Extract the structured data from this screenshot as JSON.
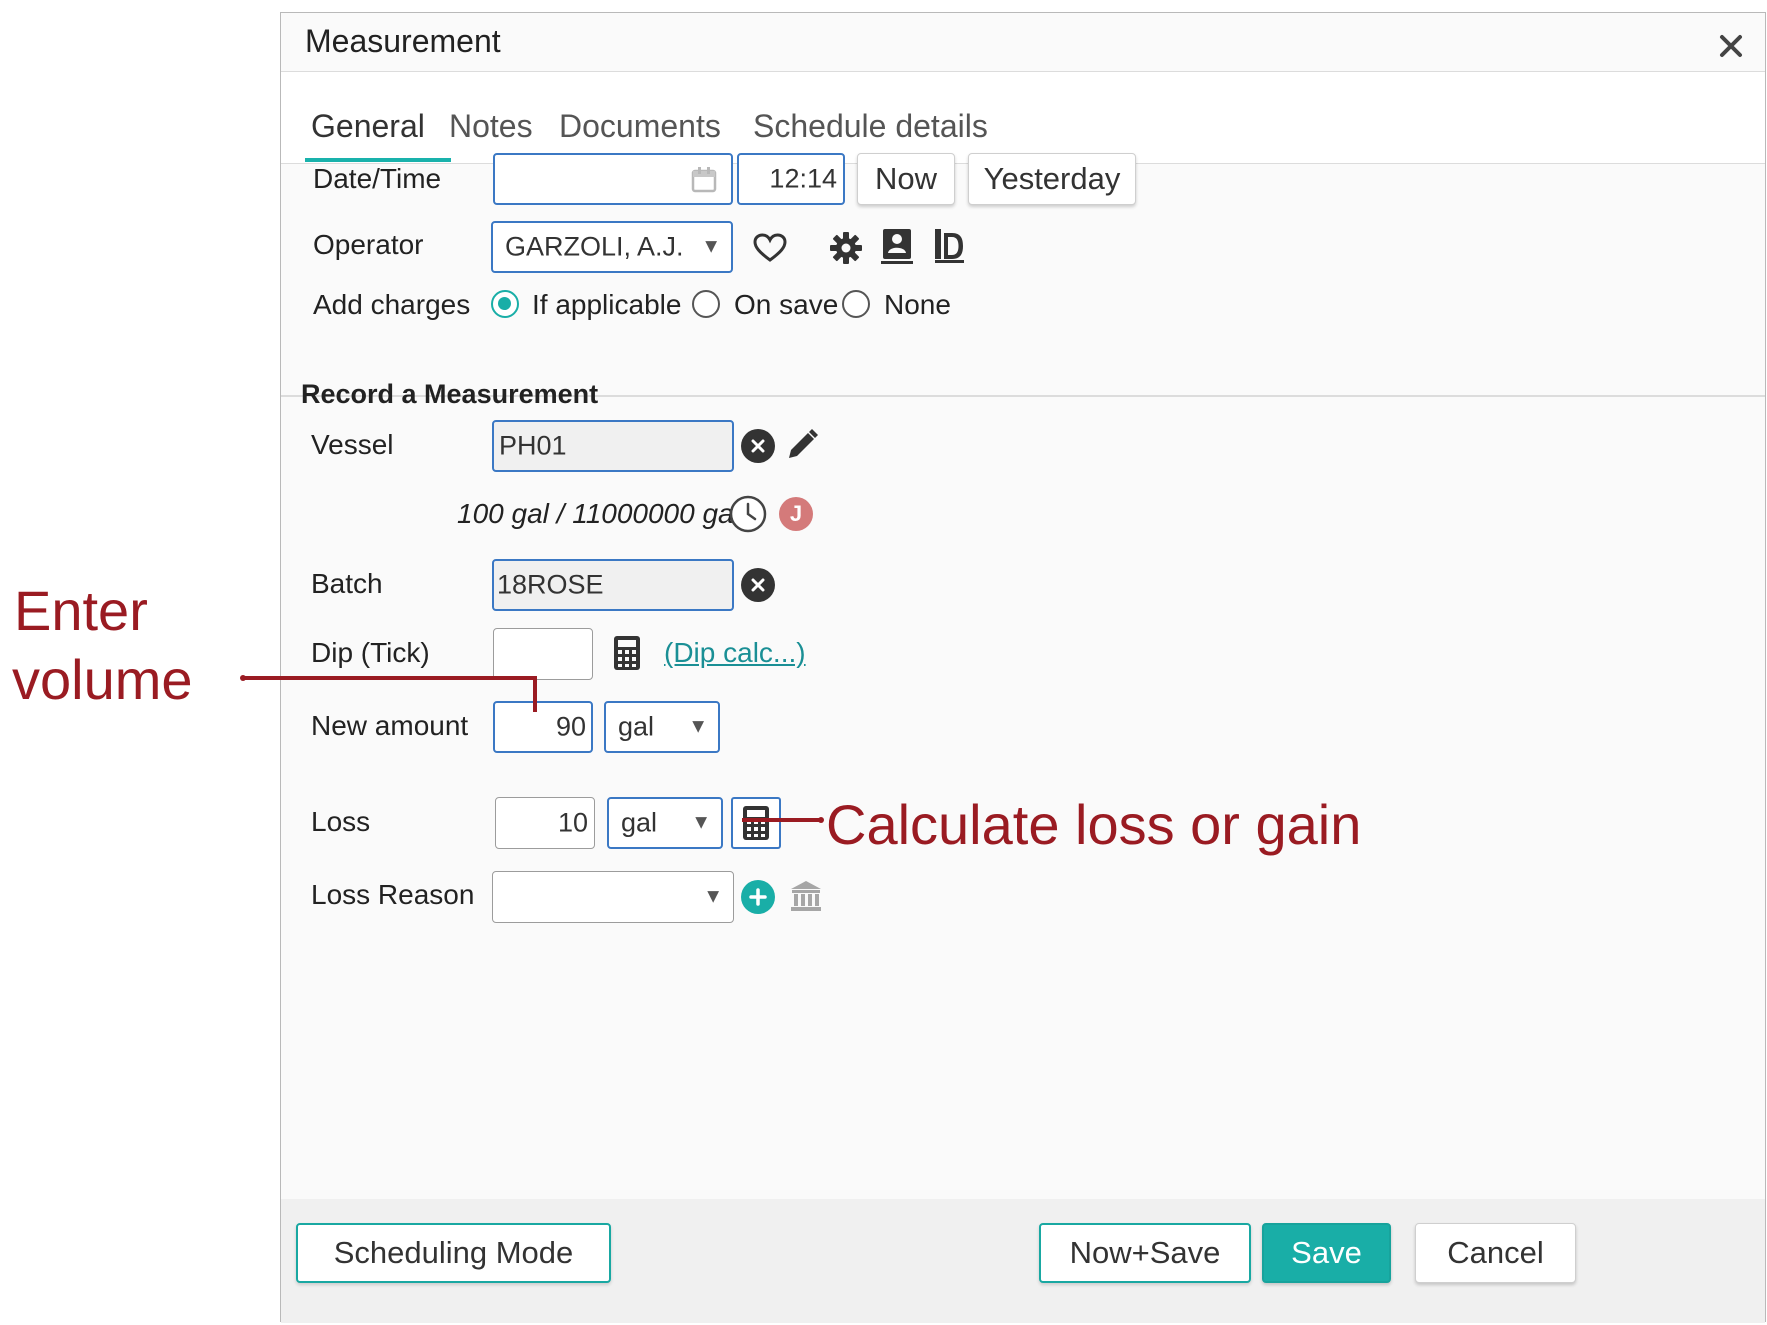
{
  "dialog": {
    "title": "Measurement",
    "close_icon": "close-icon"
  },
  "tabs": [
    {
      "label": "General",
      "active": true
    },
    {
      "label": "Notes",
      "active": false
    },
    {
      "label": "Documents",
      "active": false
    },
    {
      "label": "Schedule details",
      "active": false
    }
  ],
  "general": {
    "datetime_label": "Date/Time",
    "date_value": "",
    "time_value": "12:14",
    "now_label": "Now",
    "yesterday_label": "Yesterday",
    "operator_label": "Operator",
    "operator_value": "GARZOLI, A.J.",
    "add_charges_label": "Add charges",
    "charges_options": [
      {
        "label": "If applicable",
        "selected": true
      },
      {
        "label": "On save",
        "selected": false
      },
      {
        "label": "None",
        "selected": false
      }
    ]
  },
  "record": {
    "heading": "Record a Measurement",
    "vessel_label": "Vessel",
    "vessel_value": "PH01",
    "capacity_text": "100 gal / 11000000 gal",
    "user_badge": "J",
    "batch_label": "Batch",
    "batch_value": "18ROSE",
    "dip_label": "Dip (Tick)",
    "dip_value": "",
    "dip_calc_link": "(Dip calc...)",
    "new_amount_label": "New amount",
    "new_amount_value": "90",
    "new_amount_unit": "gal",
    "loss_label": "Loss",
    "loss_value": "10",
    "loss_unit": "gal",
    "loss_reason_label": "Loss Reason",
    "loss_reason_value": ""
  },
  "footer": {
    "scheduling_mode_label": "Scheduling Mode",
    "now_save_label": "Now+Save",
    "save_label": "Save",
    "cancel_label": "Cancel"
  },
  "annotations": {
    "enter_volume_line1": "Enter",
    "enter_volume_line2": "volume",
    "calculate_loss": "Calculate loss or gain",
    "color": "#9a1b22"
  },
  "colors": {
    "accent": "#19aea7",
    "input_border": "#3b78c4",
    "badge": "#d47a7a"
  }
}
